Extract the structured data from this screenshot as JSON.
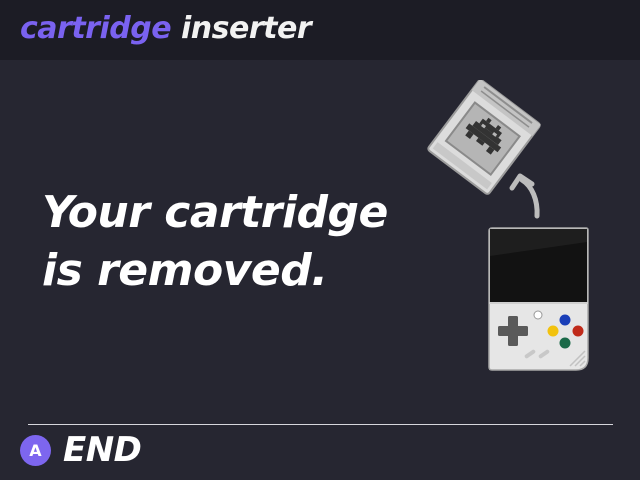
{
  "header": {
    "title_accent": "cartridge",
    "title_rest": " inserter"
  },
  "message": {
    "line1": "Your cartridge",
    "line2": "is removed."
  },
  "illustration": {
    "icons": [
      "cartridge-icon",
      "up-arrow-icon",
      "handheld-console-icon"
    ]
  },
  "footer": {
    "button_glyph": "A",
    "label": "END"
  },
  "colors": {
    "background": "#262631",
    "header_background": "#1c1c25",
    "accent": "#7a62f0",
    "text": "#ffffff"
  }
}
